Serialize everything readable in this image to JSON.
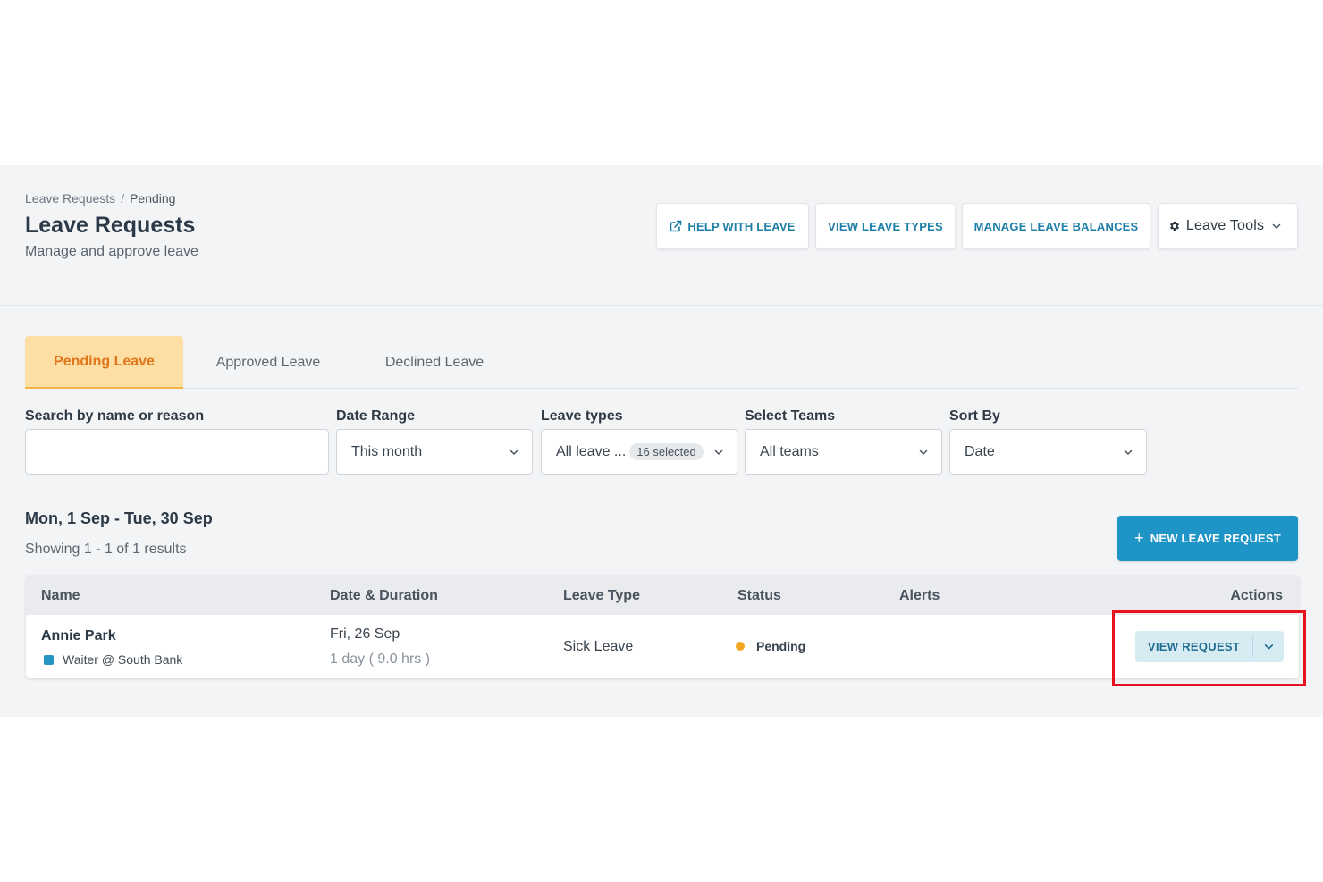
{
  "header": {
    "breadcrumb": {
      "parent": "Leave Requests",
      "separator": "/",
      "current": "Pending"
    },
    "title": "Leave Requests",
    "subtitle": "Manage and approve leave",
    "buttons": {
      "help": "HELP WITH LEAVE",
      "types": "VIEW LEAVE TYPES",
      "balances": "MANAGE LEAVE BALANCES",
      "tools": "Leave Tools"
    }
  },
  "tabs": [
    {
      "label": "Pending Leave",
      "active": true
    },
    {
      "label": "Approved Leave",
      "active": false
    },
    {
      "label": "Declined Leave",
      "active": false
    }
  ],
  "filters": {
    "search": {
      "label": "Search by name or reason",
      "value": "",
      "placeholder": ""
    },
    "date_range": {
      "label": "Date Range",
      "value": "This month"
    },
    "leave_types": {
      "label": "Leave types",
      "value": "All leave ...",
      "badge": "16 selected"
    },
    "teams": {
      "label": "Select Teams",
      "value": "All teams"
    },
    "sort": {
      "label": "Sort By",
      "value": "Date"
    }
  },
  "results": {
    "range": "Mon, 1 Sep - Tue, 30 Sep",
    "summary": "Showing 1 - 1 of 1 results",
    "new_button": "NEW LEAVE REQUEST"
  },
  "table": {
    "columns": [
      "Name",
      "Date & Duration",
      "Leave Type",
      "Status",
      "Alerts",
      "Actions"
    ],
    "rows": [
      {
        "name": "Annie Park",
        "role": "Waiter @ South Bank",
        "date": "Fri, 26 Sep",
        "duration": "1 day ( 9.0 hrs )",
        "leave_type": "Sick Leave",
        "status": "Pending",
        "alerts": "",
        "action": "VIEW REQUEST"
      }
    ]
  },
  "colors": {
    "accent": "#1f94c7",
    "tab_active_bg": "#fddfa6",
    "tab_active_text": "#e0761a",
    "status_pending": "#f5a623",
    "highlight": "#e8111c"
  }
}
